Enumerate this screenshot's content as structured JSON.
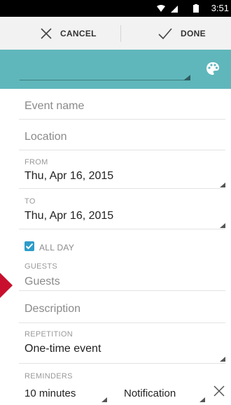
{
  "status_bar": {
    "time": "3:51"
  },
  "action_bar": {
    "cancel_label": "CANCEL",
    "done_label": "DONE"
  },
  "color_bar": {
    "color": "#5fb7bb",
    "palette_icon": "palette-icon"
  },
  "form": {
    "event_name_placeholder": "Event name",
    "location_placeholder": "Location",
    "from_label": "FROM",
    "from_value": "Thu, Apr 16, 2015",
    "to_label": "TO",
    "to_value": "Thu, Apr 16, 2015",
    "all_day_label": "ALL DAY",
    "all_day_checked": true,
    "guests_label": "GUESTS",
    "guests_placeholder": "Guests",
    "description_placeholder": "Description",
    "repetition_label": "REPETITION",
    "repetition_value": "One-time event",
    "reminders_label": "REMINDERS",
    "reminder_time": "10 minutes",
    "reminder_type": "Notification"
  }
}
